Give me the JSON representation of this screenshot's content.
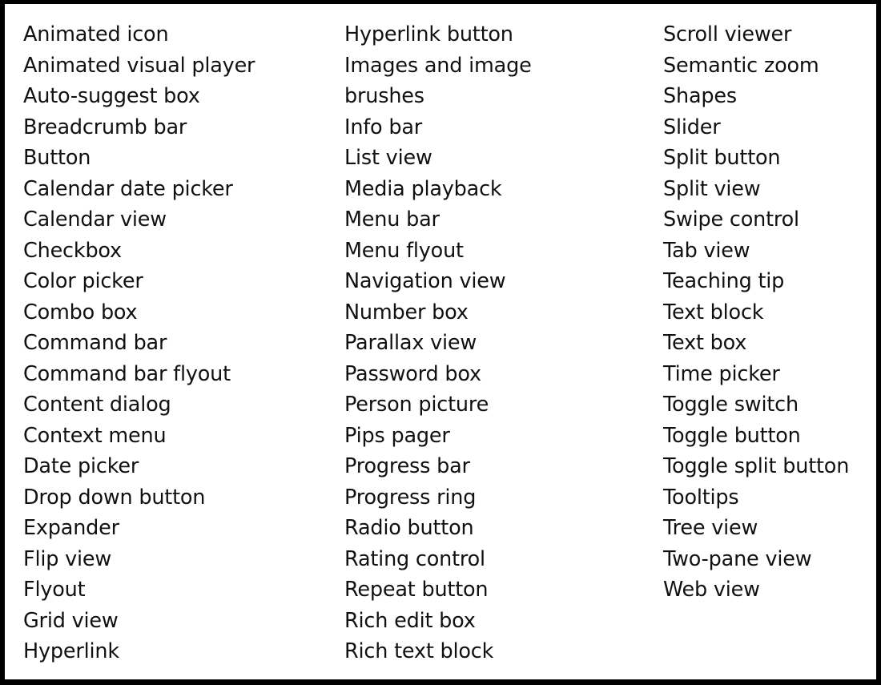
{
  "columns": [
    {
      "items": [
        "Animated icon",
        "Animated visual player",
        "Auto-suggest box",
        "Breadcrumb bar",
        "Button",
        "Calendar date picker",
        "Calendar view",
        "Checkbox",
        "Color picker",
        "Combo box",
        "Command bar",
        "Command bar flyout",
        "Content dialog",
        "Context menu",
        "Date picker",
        "Drop down button",
        "Expander",
        "Flip view",
        "Flyout",
        "Grid view",
        "Hyperlink"
      ]
    },
    {
      "items": [
        "Hyperlink button",
        "Images and image",
        "brushes",
        "Info bar",
        "List view",
        "Media playback",
        "Menu bar",
        "Menu flyout",
        "Navigation view",
        "Number box",
        "Parallax view",
        "Password box",
        "Person picture",
        "Pips pager",
        "Progress bar",
        "Progress ring",
        "Radio button",
        "Rating control",
        "Repeat button",
        "Rich edit box",
        "Rich text block"
      ]
    },
    {
      "items": [
        "Scroll viewer",
        "Semantic zoom",
        "Shapes",
        "Slider",
        "Split button",
        "Split view",
        "Swipe control",
        "Tab view",
        "Teaching tip",
        "Text block",
        "Text box",
        "Time picker",
        "Toggle switch",
        "Toggle button",
        "Toggle split button",
        "Tooltips",
        "Tree view",
        "Two-pane view",
        "Web view"
      ]
    }
  ]
}
